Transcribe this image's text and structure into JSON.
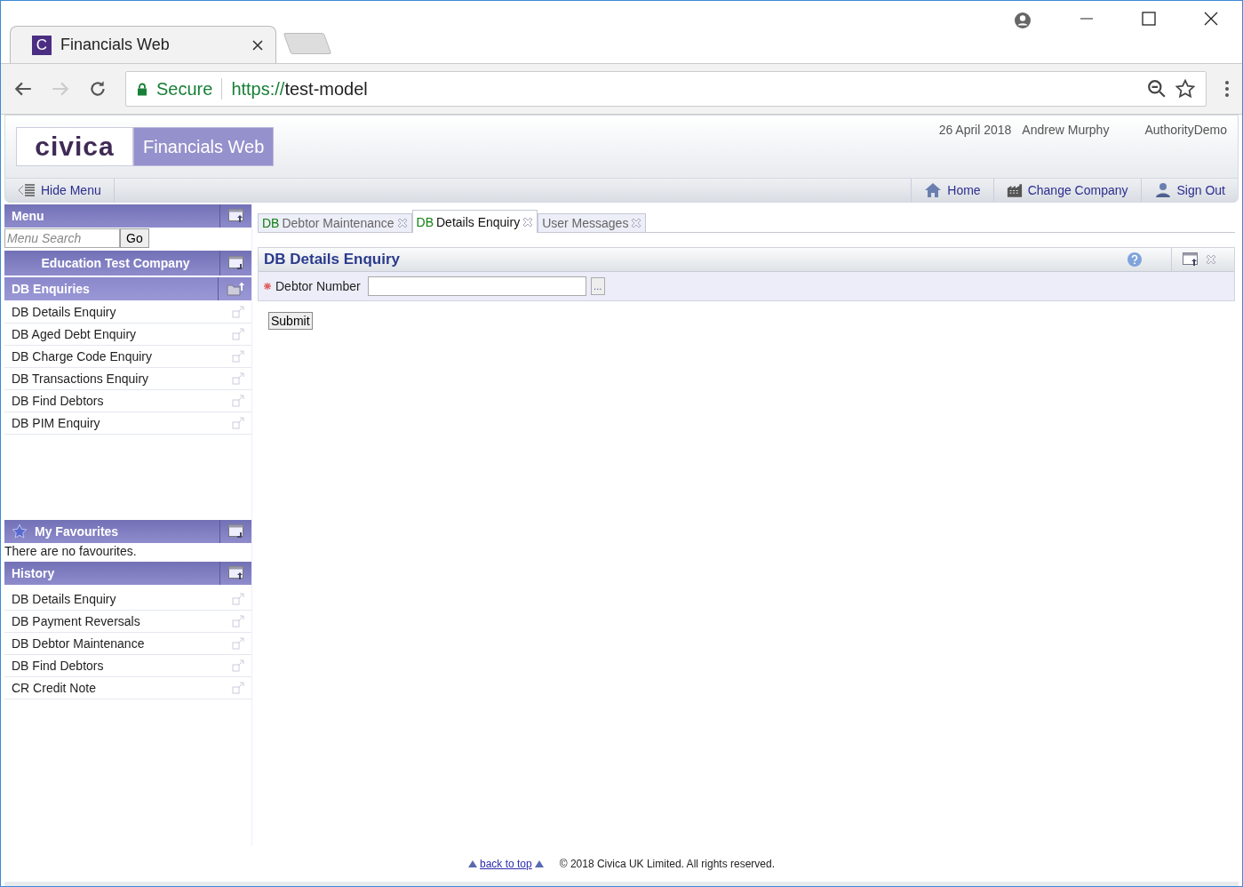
{
  "browser": {
    "favicon_letter": "C",
    "tab_title": "Financials Web",
    "secure_label": "Secure",
    "url_scheme": "https://",
    "url_host": "test-model"
  },
  "header": {
    "logo_text": "civica",
    "product": "Financials Web",
    "date": "26 April 2018",
    "user": "Andrew Murphy",
    "authority": "AuthorityDemo"
  },
  "toolbar": {
    "hide_menu": "Hide Menu",
    "links": [
      {
        "kind": "home",
        "label": "Home"
      },
      {
        "kind": "company",
        "label": "Change Company"
      },
      {
        "kind": "signout",
        "label": "Sign Out"
      }
    ]
  },
  "sidebar": {
    "menu_title": "Menu",
    "search": {
      "placeholder": "Menu Search"
    },
    "go": "Go",
    "company": "Education Test Company",
    "section_title": "DB Enquiries",
    "items": [
      "DB Details Enquiry",
      "DB Aged Debt Enquiry",
      "DB Charge Code Enquiry",
      "DB Transactions Enquiry",
      "DB Find Debtors",
      "DB PIM Enquiry"
    ],
    "favourites_title": "My Favourites",
    "favourites_empty": "There are no favourites.",
    "history_title": "History",
    "history": [
      "DB Details Enquiry",
      "DB Payment Reversals",
      "DB Debtor Maintenance",
      "DB Find Debtors",
      "CR Credit Note"
    ]
  },
  "tabs": [
    {
      "prefix": "DB",
      "label": "Debtor Maintenance",
      "selected": false
    },
    {
      "prefix": "DB",
      "label": "Details Enquiry",
      "selected": true
    },
    {
      "label": "User Messages",
      "selected": false
    }
  ],
  "form": {
    "title": "DB Details Enquiry",
    "field_label": "Debtor Number",
    "required": true,
    "lookup": "...",
    "submit": "Submit"
  },
  "footer": {
    "back_to_top": "back to top",
    "copyright": "© 2018 Civica UK Limited. All rights reserved."
  }
}
